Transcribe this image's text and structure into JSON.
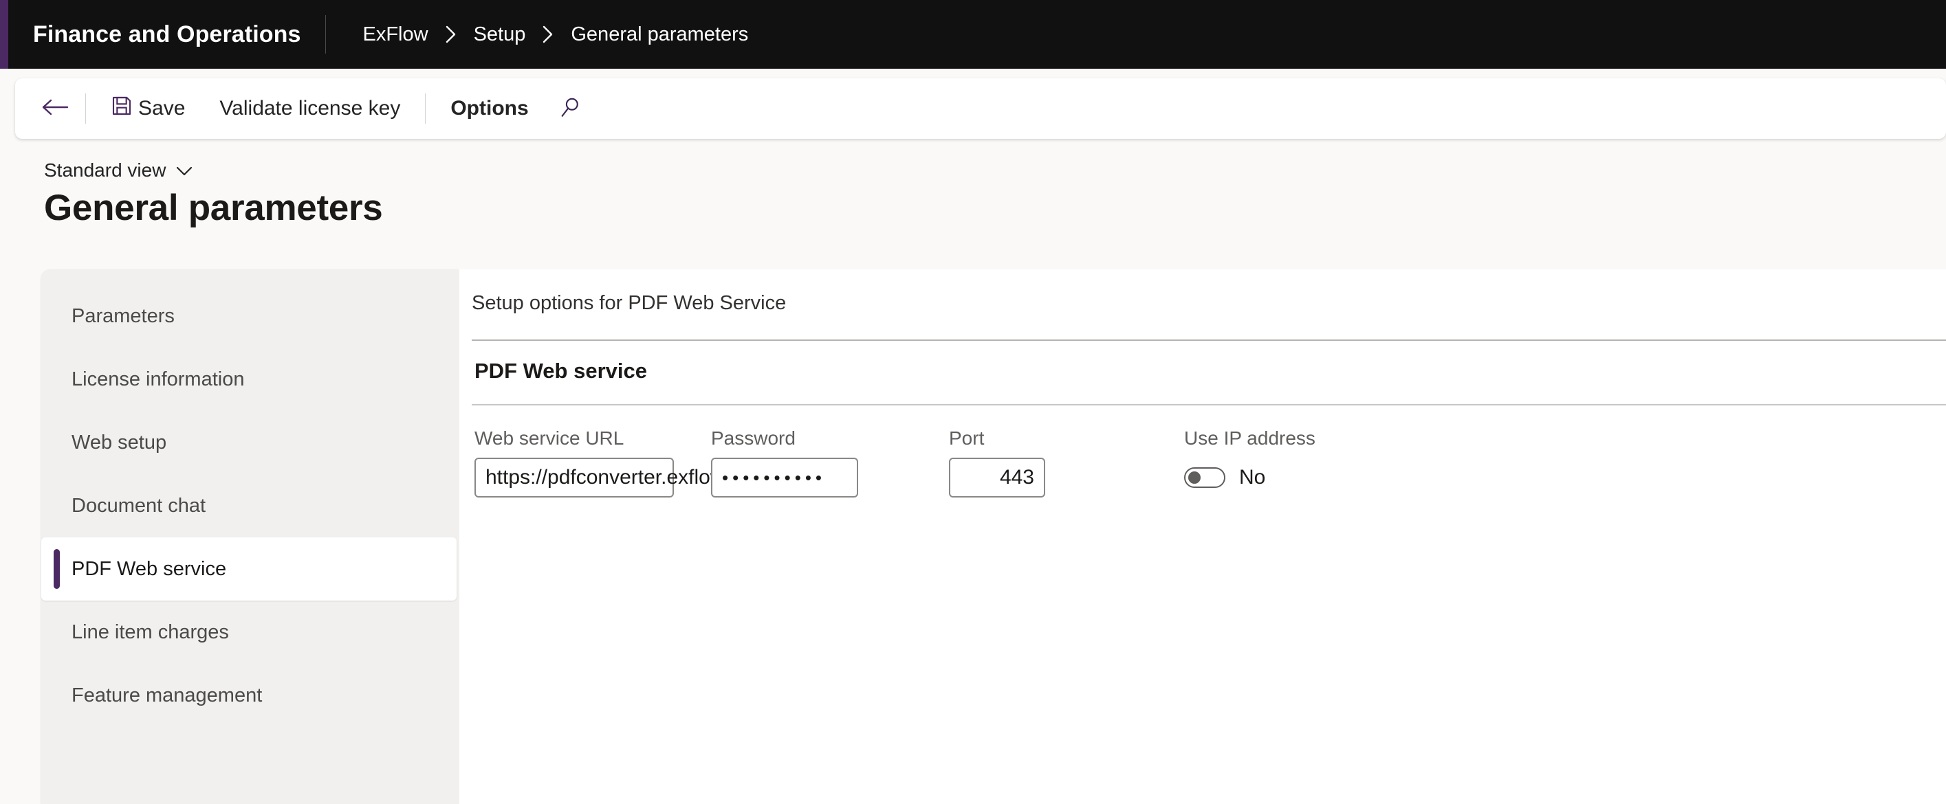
{
  "header": {
    "app_title": "Finance and Operations",
    "breadcrumb": [
      "ExFlow",
      "Setup",
      "General parameters"
    ]
  },
  "toolbar": {
    "back_icon": "arrow-left-icon",
    "save_icon": "floppy-save-icon",
    "save_label": "Save",
    "validate_label": "Validate license key",
    "options_label": "Options",
    "search_icon": "search-icon"
  },
  "page": {
    "view_label": "Standard view",
    "view_chevron": "chevron-down-icon",
    "title": "General parameters"
  },
  "sidebar": {
    "items": [
      {
        "label": "Parameters",
        "selected": false
      },
      {
        "label": "License information",
        "selected": false
      },
      {
        "label": "Web setup",
        "selected": false
      },
      {
        "label": "Document chat",
        "selected": false
      },
      {
        "label": "PDF Web service",
        "selected": true
      },
      {
        "label": "Line item charges",
        "selected": false
      },
      {
        "label": "Feature management",
        "selected": false
      }
    ]
  },
  "content": {
    "subtitle": "Setup options for PDF Web Service",
    "section_title": "PDF Web service",
    "fields": {
      "url": {
        "label": "Web service URL",
        "value": "https://pdfconverter.exflow.io"
      },
      "password": {
        "label": "Password",
        "value": "••••••••••"
      },
      "port": {
        "label": "Port",
        "value": "443"
      },
      "use_ip": {
        "label": "Use IP address",
        "state_text": "No",
        "checked": false
      }
    }
  },
  "colors": {
    "brand_purple": "#4b2a63",
    "header_black": "#111111",
    "page_bg": "#faf9f8",
    "panel_bg": "#f1f0ef"
  }
}
